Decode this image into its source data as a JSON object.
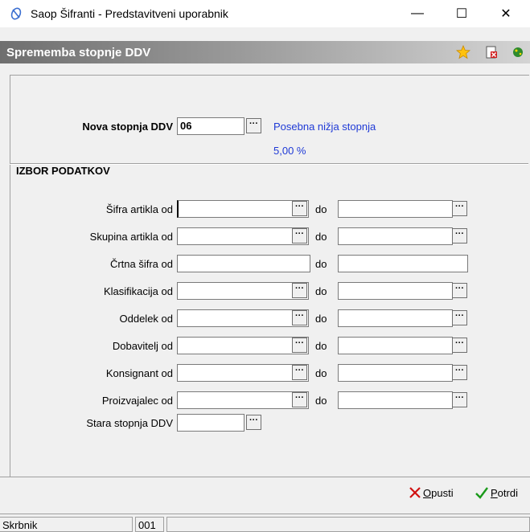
{
  "window": {
    "title": "Saop Šifranti - Predstavitveni uporabnik",
    "minimize": "—",
    "maximize": "☐",
    "close": "✕"
  },
  "header": {
    "title": "Sprememba stopnje DDV"
  },
  "top": {
    "nova_label": "Nova stopnja DDV",
    "nova_value": "06",
    "nova_desc": "Posebna nižja stopnja",
    "nova_percent": "5,00 %"
  },
  "group": {
    "label": "IZBOR PODATKOV"
  },
  "rows": [
    {
      "label": "Šifra artikla od",
      "do": "do"
    },
    {
      "label": "Skupina artikla od",
      "do": "do"
    },
    {
      "label": "Črtna šifra od",
      "do": "do"
    },
    {
      "label": "Klasifikacija od",
      "do": "do"
    },
    {
      "label": "Oddelek od",
      "do": "do"
    },
    {
      "label": "Dobavitelj od",
      "do": "do"
    },
    {
      "label": "Konsignant od",
      "do": "do"
    },
    {
      "label": "Proizvajalec od",
      "do": "do"
    }
  ],
  "stara": {
    "label": "Stara stopnja DDV"
  },
  "buttons": {
    "cancel_mn": "O",
    "cancel_rest": "pusti",
    "confirm_mn": "P",
    "confirm_rest": "otrdi"
  },
  "status": {
    "user": "Skrbnik",
    "code": "001"
  },
  "dots": "···"
}
